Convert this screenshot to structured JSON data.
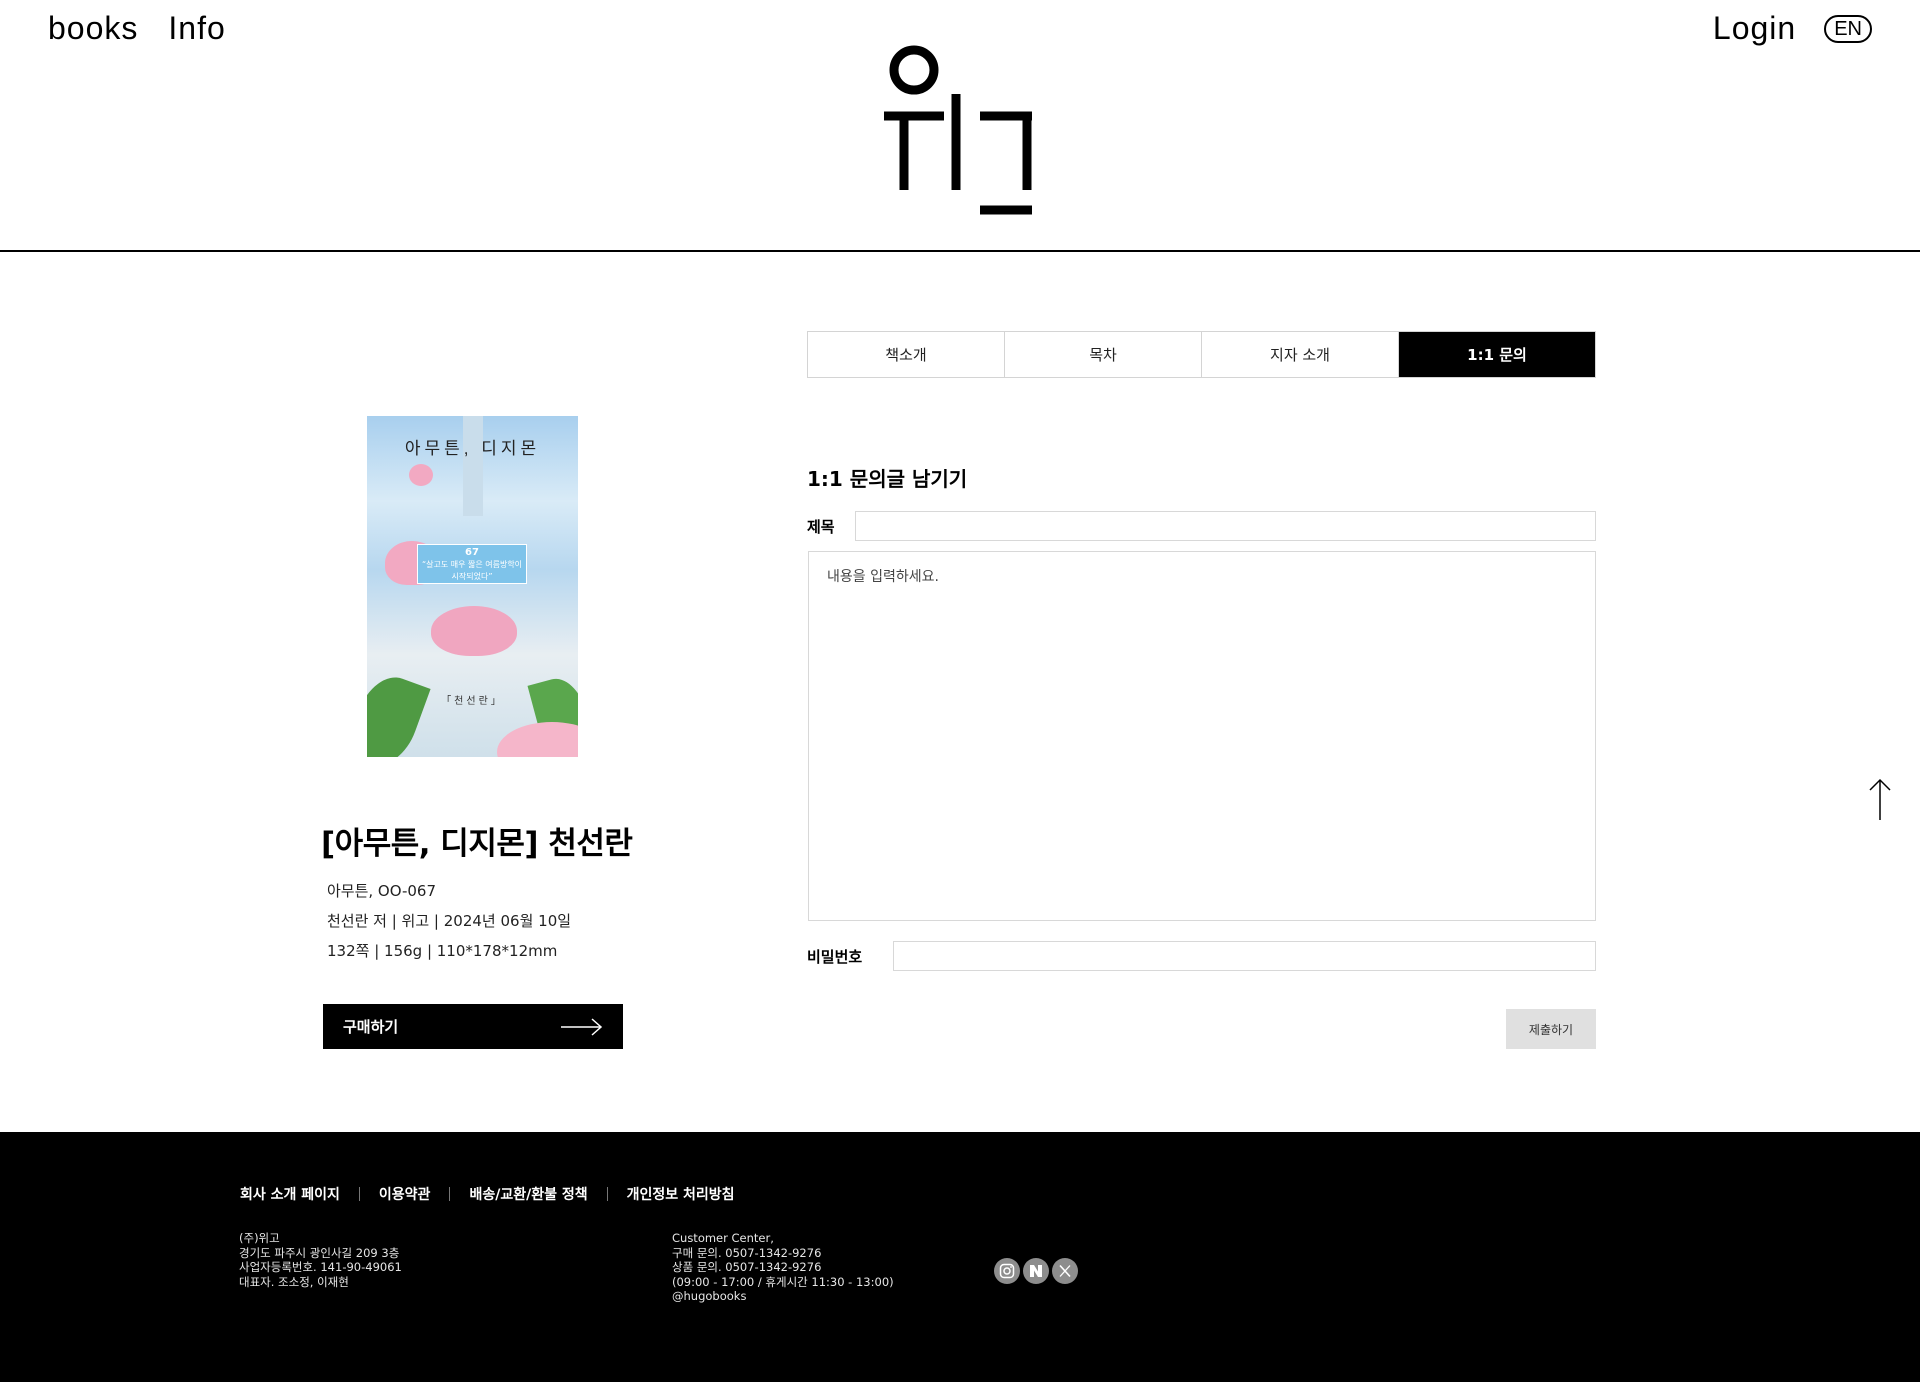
{
  "header": {
    "nav_left": [
      "books",
      "Info"
    ],
    "login": "Login",
    "lang": "EN",
    "logo_text": "위고"
  },
  "book": {
    "cover": {
      "title": "아무튼, 디지몬",
      "number": "67",
      "quote": "“살고도 매우 짧은 여름방학이 시작되었다”",
      "author": "「천선란」"
    },
    "title": "[아무튼, 디지몬] 천선란",
    "meta": [
      "아무튼, OO-067",
      "천선란 저 | 위고 | 2024년 06월 10일",
      "132쪽 | 156g | 110*178*12mm"
    ],
    "buy_label": "구매하기"
  },
  "tabs": [
    {
      "label": "책소개",
      "active": false
    },
    {
      "label": "목차",
      "active": false
    },
    {
      "label": "지자 소개",
      "active": false
    },
    {
      "label": "1:1 문의",
      "active": true
    }
  ],
  "form": {
    "title": "1:1 문의글 남기기",
    "subject_label": "제목",
    "subject_value": "",
    "content_placeholder": "내용을 입력하세요.",
    "password_label": "비밀번호",
    "password_value": "",
    "submit_label": "제출하기"
  },
  "footer": {
    "links": [
      "회사 소개 페이지",
      "이용약관",
      "배송/교환/환불 정책",
      "개인정보 처리방침"
    ],
    "company": [
      "(주)위고",
      "경기도 파주시 광인사길 209 3층",
      "사업자등록번호. 141-90-49061",
      "대표자. 조소정, 이재현"
    ],
    "customer": [
      "Customer Center,",
      "구매 문의. 0507-1342-9276",
      "상품 문의. 0507-1342-9276",
      "(09:00 - 17:00 / 휴게시간 11:30 - 13:00)",
      "@hugobooks"
    ],
    "socials": [
      "instagram-icon",
      "naver-icon",
      "x-icon"
    ]
  }
}
